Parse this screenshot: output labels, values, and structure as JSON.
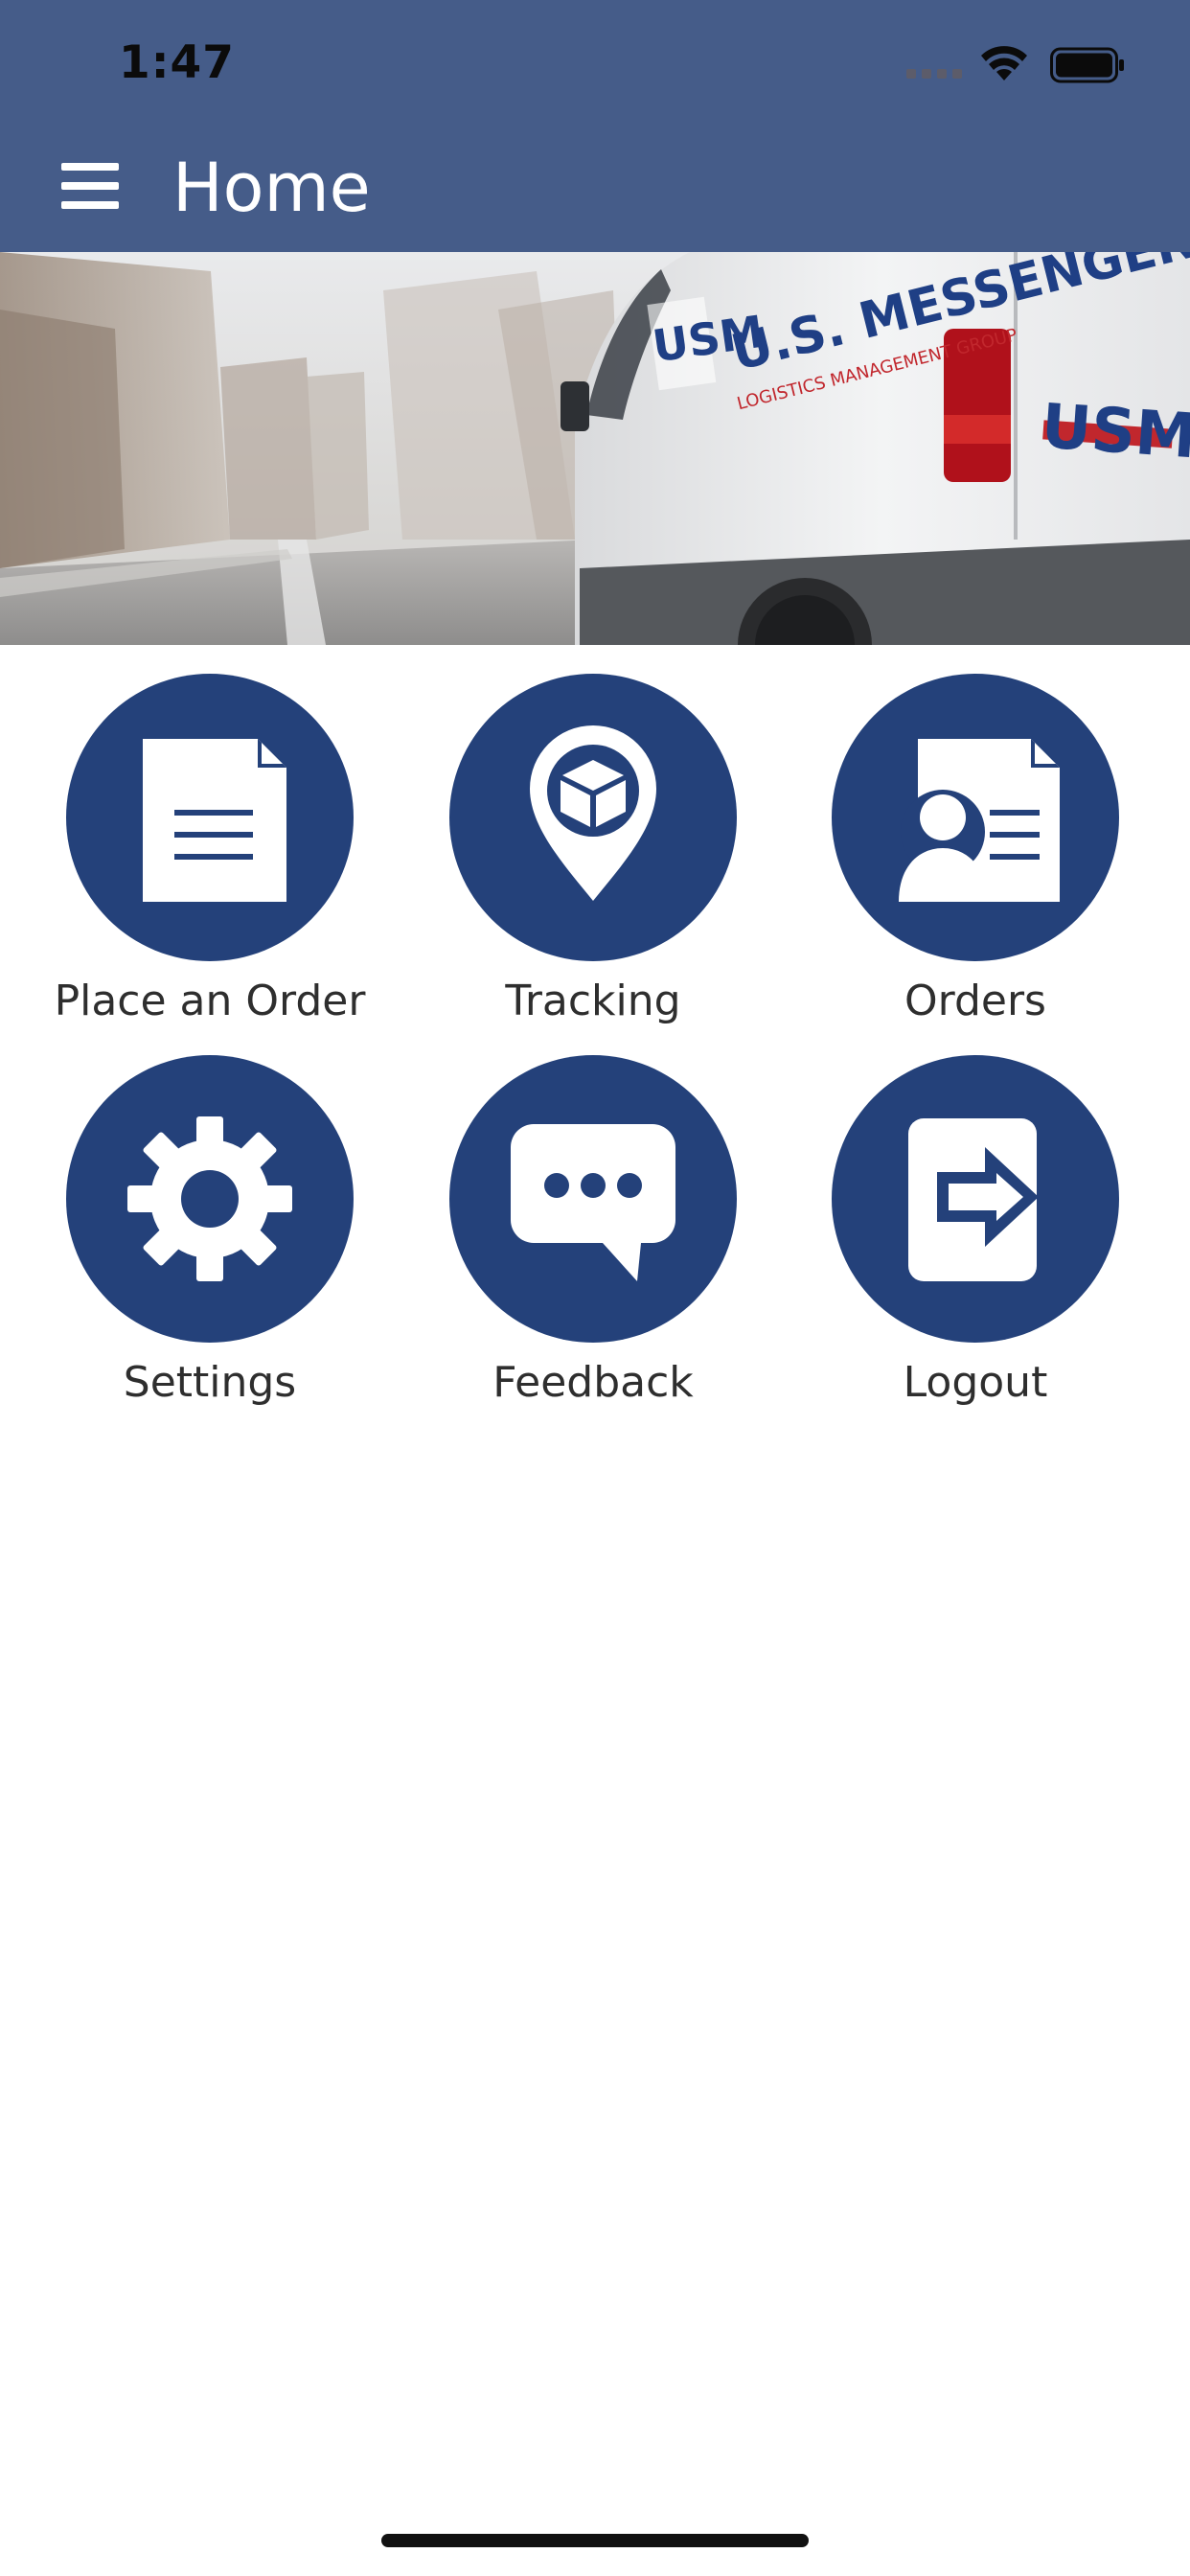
{
  "status_bar": {
    "time": "1:47"
  },
  "header": {
    "title": "Home",
    "menu_icon": "hamburger-menu-icon",
    "background": "#455c89"
  },
  "hero": {
    "image": "delivery-van-photo",
    "van_brand_text": "U.S. MESSENGER",
    "van_tagline": "LOGISTICS MANAGEMENT GROUP",
    "logo_text": "USM"
  },
  "tiles": [
    {
      "label": "Place an Order",
      "icon": "document-icon"
    },
    {
      "label": "Tracking",
      "icon": "package-location-pin-icon"
    },
    {
      "label": "Orders",
      "icon": "user-document-icon"
    },
    {
      "label": "Settings",
      "icon": "gear-icon"
    },
    {
      "label": "Feedback",
      "icon": "chat-bubble-icon"
    },
    {
      "label": "Logout",
      "icon": "logout-arrow-icon"
    }
  ],
  "accent_color": "#24417a"
}
